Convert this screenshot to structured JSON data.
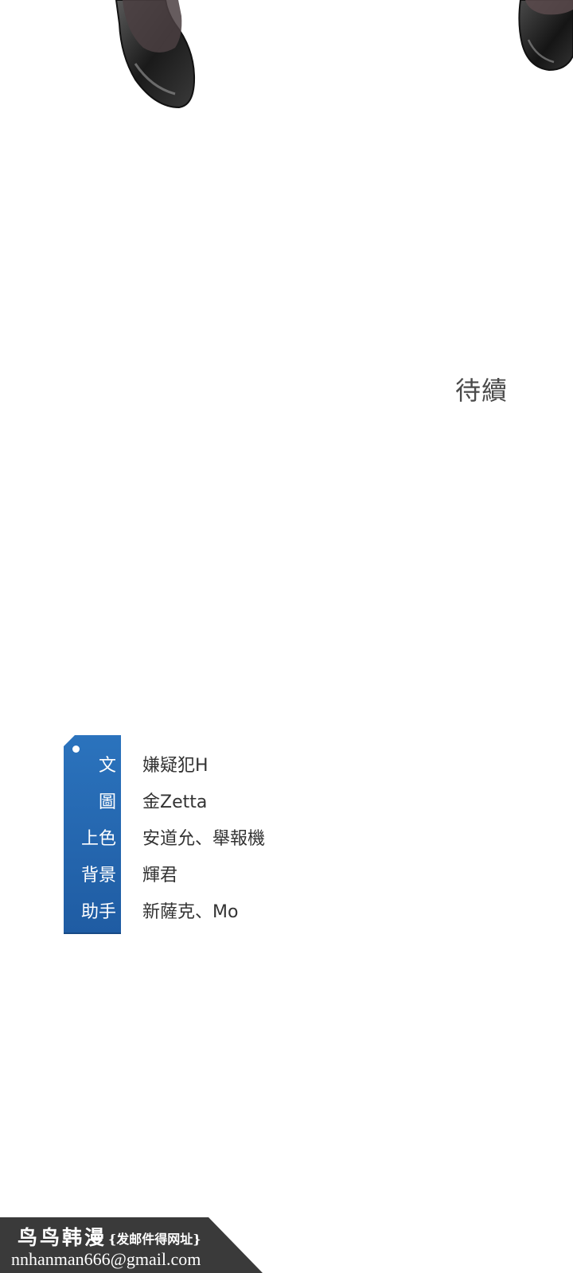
{
  "status_text": "待續",
  "credits": [
    {
      "role": "文",
      "name": "嫌疑犯H"
    },
    {
      "role": "圖",
      "name": "金Zetta"
    },
    {
      "role": "上色",
      "name": "安道允、舉報機"
    },
    {
      "role": "背景",
      "name": "輝君"
    },
    {
      "role": "助手",
      "name": "新薩克、Mo"
    }
  ],
  "banner": {
    "title": "鸟鸟韩漫",
    "subtitle": "{发邮件得网址}",
    "email": "nnhanman666@gmail.com"
  },
  "colors": {
    "tag_blue": "#2566ad",
    "banner_dark": "#3a3a3a",
    "text": "#333333"
  }
}
